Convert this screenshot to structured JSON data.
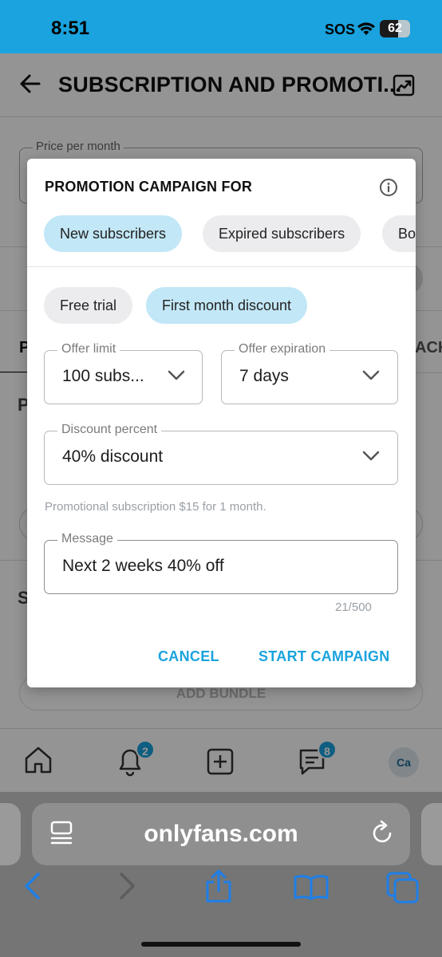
{
  "status_bar": {
    "time": "8:51",
    "carrier": "SOS",
    "battery": "62"
  },
  "header": {
    "title": "SUBSCRIPTION AND PROMOTI..."
  },
  "background": {
    "price_label": "Price per month",
    "tab_partial_left": "P",
    "tab_partial_right": "ACK",
    "bundle_button": "ADD BUNDLE"
  },
  "nav": {
    "notifications_badge": "2",
    "messages_badge": "8",
    "avatar_initials": "Ca"
  },
  "modal": {
    "title": "PROMOTION CAMPAIGN FOR",
    "audience_chips": [
      "New subscribers",
      "Expired subscribers",
      "Bo"
    ],
    "type_chips": [
      "Free trial",
      "First month discount"
    ],
    "offer_limit": {
      "label": "Offer limit",
      "value": "100 subs..."
    },
    "offer_expiration": {
      "label": "Offer expiration",
      "value": "7 days"
    },
    "discount_percent": {
      "label": "Discount percent",
      "value": "40% discount"
    },
    "promo_note": "Promotional subscription $15 for 1 month.",
    "message": {
      "label": "Message",
      "value": "Next 2 weeks 40% off"
    },
    "char_count": "21/500",
    "cancel_label": "CANCEL",
    "start_label": "START CAMPAIGN"
  },
  "browser": {
    "url": "onlyfans.com"
  }
}
